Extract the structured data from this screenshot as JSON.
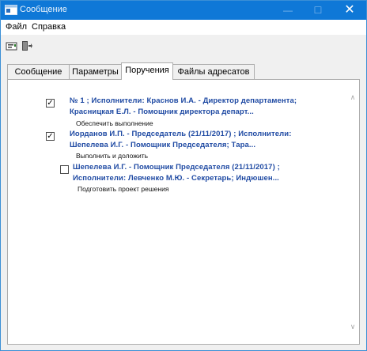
{
  "window": {
    "title": "Сообщение",
    "minimize": "—",
    "maximize": "☐",
    "close": "✕"
  },
  "menu": {
    "file": "Файл",
    "help": "Справка"
  },
  "toolbar": {
    "send_icon": "envelope-icon",
    "exit_icon": "exit-door-icon"
  },
  "tabs": [
    {
      "label": "Сообщение",
      "active": false
    },
    {
      "label": "Параметры",
      "active": false
    },
    {
      "label": "Поручения",
      "active": true
    },
    {
      "label": "Файлы адресатов",
      "active": false
    }
  ],
  "assignments": [
    {
      "checked": true,
      "line1": "№ 1 ; Исполнители: Краснов И.А. - Директор департамента;",
      "line2": "Красницкая Е.Л. - Помощник директора департ...",
      "note": "Обеспечить выполнение"
    },
    {
      "checked": true,
      "line1": "Иорданов И.П. - Председатель (21/11/2017) ; Исполнители:",
      "line2": "Шепелева И.Г. - Помощник Председателя; Тара...",
      "note": "Выполнить и доложить"
    },
    {
      "checked": false,
      "line1": "Шепелева И.Г. - Помощник Председателя (21/11/2017) ;",
      "line2": "Исполнители: Левченко М.Ю. - Секретарь; Индюшен...",
      "note": "Подготовить проект решения"
    }
  ],
  "scrollbar": {
    "up": "∧",
    "down": "∨"
  }
}
